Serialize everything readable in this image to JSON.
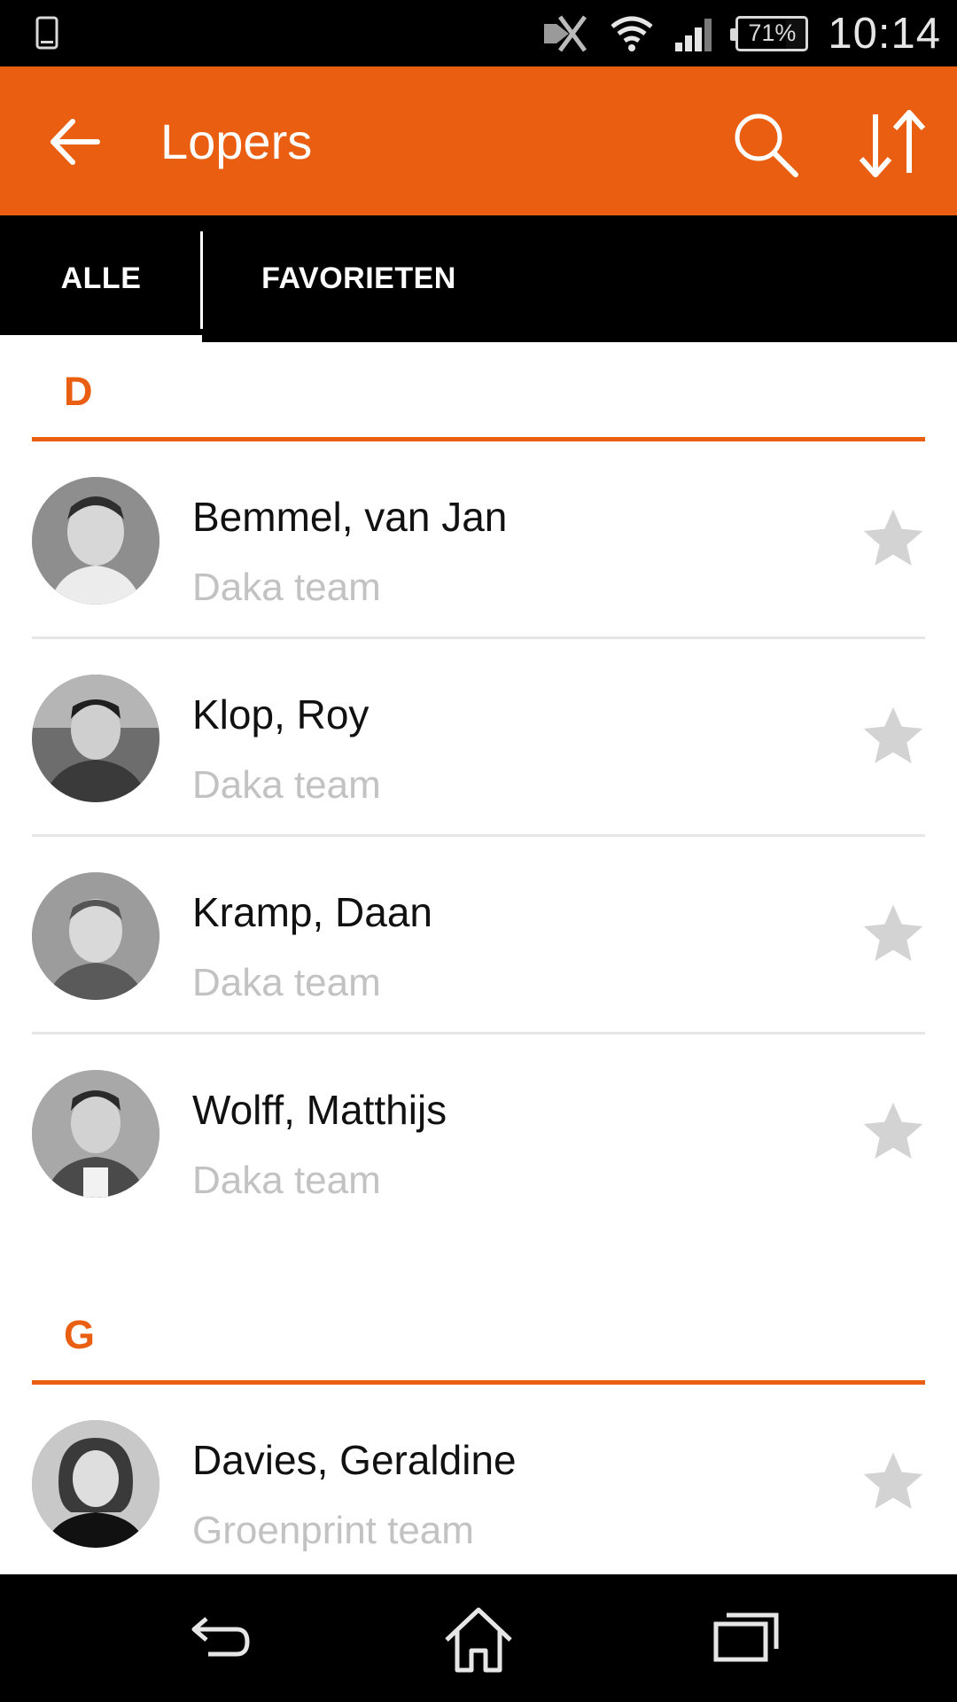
{
  "status_bar": {
    "battery": "71%",
    "time": "10:14",
    "icons": [
      "phone-outline-icon",
      "nfc-off-icon",
      "wifi-icon",
      "signal-icon",
      "battery-icon"
    ]
  },
  "app_bar": {
    "title": "Lopers",
    "icons": [
      "arrow-back-icon",
      "search-icon",
      "sort-icon"
    ],
    "color": "#e95e10"
  },
  "tabs": [
    {
      "label": "ALLE",
      "selected": true
    },
    {
      "label": "FAVORIETEN",
      "selected": false
    }
  ],
  "sections": [
    {
      "letter": "D",
      "items": [
        {
          "name": "Bemmel, van Jan",
          "team": "Daka team"
        },
        {
          "name": "Klop, Roy",
          "team": "Daka team"
        },
        {
          "name": "Kramp, Daan",
          "team": "Daka team"
        },
        {
          "name": "Wolff, Matthijs",
          "team": "Daka team"
        }
      ]
    },
    {
      "letter": "G",
      "items": [
        {
          "name": "Davies, Geraldine",
          "team": "Groenprint team"
        }
      ]
    }
  ],
  "colors": {
    "accent": "#e95e10",
    "star": "#d3d3d3",
    "team_text": "#c2c2c2"
  },
  "nav_bar": {
    "icons": [
      "nav-back-icon",
      "nav-home-icon",
      "nav-recents-icon"
    ]
  }
}
